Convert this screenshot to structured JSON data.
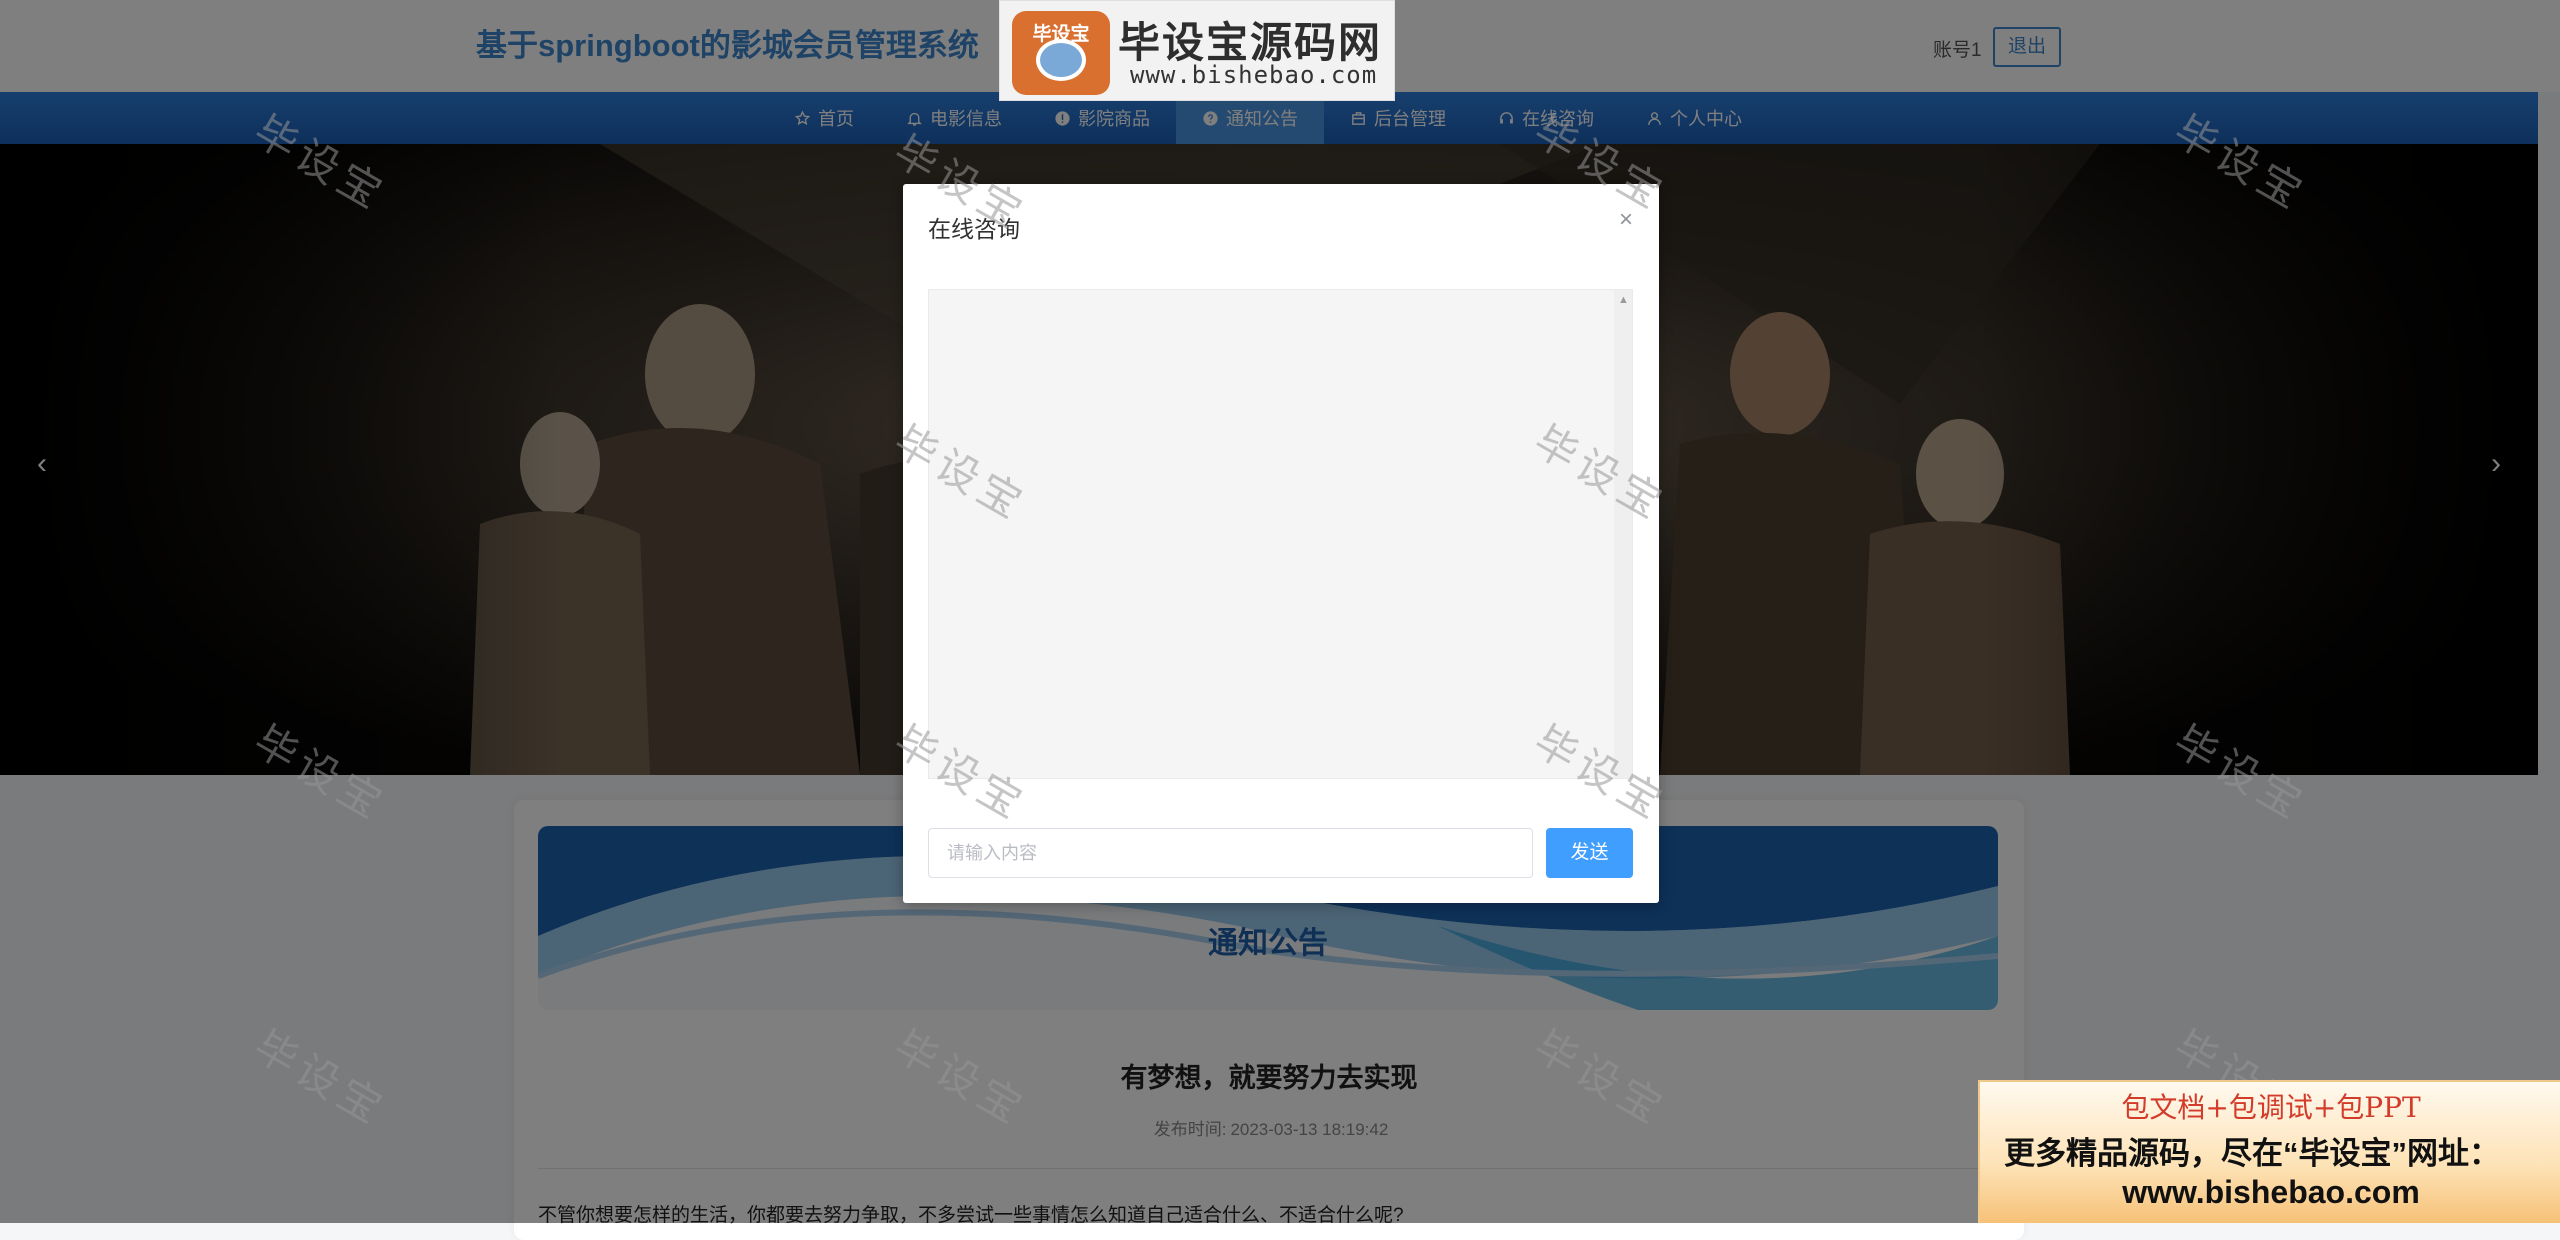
{
  "header": {
    "site_title": "基于springboot的影城会员管理系统",
    "account": "账号1",
    "logout_label": "退出"
  },
  "logo_watermark": {
    "badge": "毕设宝",
    "name": "毕设宝源码网",
    "url": "www.bishebao.com"
  },
  "nav": {
    "items": [
      {
        "label": "首页",
        "icon": "star-icon"
      },
      {
        "label": "电影信息",
        "icon": "bell-icon"
      },
      {
        "label": "影院商品",
        "icon": "info-circle-icon"
      },
      {
        "label": "通知公告",
        "icon": "question-circle-icon",
        "active": true
      },
      {
        "label": "后台管理",
        "icon": "briefcase-icon"
      },
      {
        "label": "在线咨询",
        "icon": "headset-icon"
      },
      {
        "label": "个人中心",
        "icon": "user-icon"
      }
    ]
  },
  "banner": {
    "prev_icon": "chevron-left-icon",
    "next_icon": "chevron-right-icon",
    "prev": "‹",
    "next": "›"
  },
  "content": {
    "section_title": "通知公告",
    "article_title": "有梦想，就要努力去实现",
    "date_label": "发布时间:",
    "date_value": "2023-03-13 18:19:42",
    "body_text": "不管你想要怎样的生活，你都要去努力争取，不多尝试一些事情怎么知道自己适合什么、不适合什么呢?"
  },
  "modal": {
    "title": "在线咨询",
    "close_icon": "close-icon",
    "close": "×",
    "input_placeholder": "请输入内容",
    "input_value": "",
    "send_label": "发送"
  },
  "watermark_text": "毕设宝",
  "ad": {
    "line1": "包文档+包调试+包PPT",
    "line2": "更多精品源码，尽在“毕设宝”网址：",
    "line3": "www.bishebao.com"
  },
  "colors": {
    "accent": "#3c87cf",
    "nav_bg": "#1f66c0",
    "send_button": "#409eff"
  }
}
